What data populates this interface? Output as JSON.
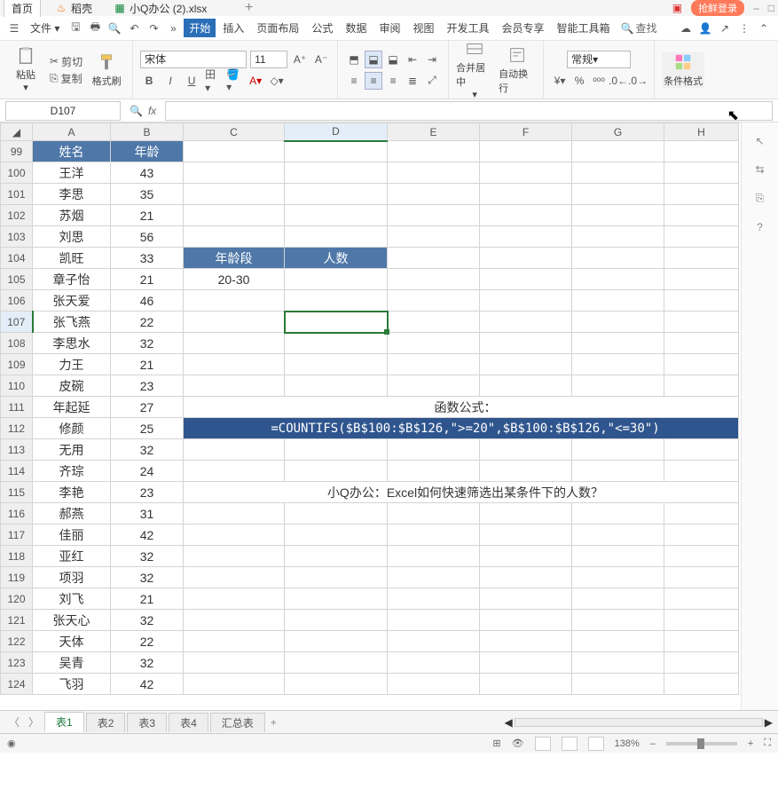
{
  "tabs": {
    "home": "首页",
    "daoke": "稻壳",
    "file": "小Q办公 (2).xlsx"
  },
  "login": "抢鲜登录",
  "menubar": {
    "file": "文件",
    "start": "开始",
    "insert": "插入",
    "layout": "页面布局",
    "formula": "公式",
    "data": "数据",
    "review": "审阅",
    "view": "视图",
    "dev": "开发工具",
    "member": "会员专享",
    "ai": "智能工具箱",
    "find": "查找"
  },
  "ribbon": {
    "paste": "粘贴",
    "cut": "剪切",
    "copy": "复制",
    "format": "格式刷",
    "font": "宋体",
    "size": "11",
    "merge": "合并居中",
    "wrap": "自动换行",
    "numformat": "常规",
    "cond": "条件格式"
  },
  "namebox": "D107",
  "cols": [
    "A",
    "B",
    "C",
    "D",
    "E",
    "F",
    "G",
    "H"
  ],
  "rows": [
    {
      "n": "99",
      "a": "姓名",
      "b": "年龄",
      "hdr": true
    },
    {
      "n": "100",
      "a": "王洋",
      "b": "43"
    },
    {
      "n": "101",
      "a": "李思",
      "b": "35"
    },
    {
      "n": "102",
      "a": "苏烟",
      "b": "21"
    },
    {
      "n": "103",
      "a": "刘思",
      "b": "56"
    },
    {
      "n": "104",
      "a": "凯旺",
      "b": "33",
      "c": "年龄段",
      "d": "人数",
      "chdr": true
    },
    {
      "n": "105",
      "a": "章子怡",
      "b": "21",
      "c": "20-30"
    },
    {
      "n": "106",
      "a": "张天爱",
      "b": "46"
    },
    {
      "n": "107",
      "a": "张飞燕",
      "b": "22",
      "selrow": true
    },
    {
      "n": "108",
      "a": "李思水",
      "b": "32"
    },
    {
      "n": "109",
      "a": "力王",
      "b": "21"
    },
    {
      "n": "110",
      "a": "皮碗",
      "b": "23"
    },
    {
      "n": "111",
      "a": "年起延",
      "b": "27",
      "note_row": "red1"
    },
    {
      "n": "112",
      "a": "修颜",
      "b": "25",
      "note_row": "formula"
    },
    {
      "n": "113",
      "a": "无用",
      "b": "32"
    },
    {
      "n": "114",
      "a": "齐琮",
      "b": "24"
    },
    {
      "n": "115",
      "a": "李艳",
      "b": "23",
      "note_row": "red2"
    },
    {
      "n": "116",
      "a": "郝燕",
      "b": "31"
    },
    {
      "n": "117",
      "a": "佳丽",
      "b": "42"
    },
    {
      "n": "118",
      "a": "亚红",
      "b": "32"
    },
    {
      "n": "119",
      "a": "项羽",
      "b": "32"
    },
    {
      "n": "120",
      "a": "刘飞",
      "b": "21"
    },
    {
      "n": "121",
      "a": "张天心",
      "b": "32"
    },
    {
      "n": "122",
      "a": "天体",
      "b": "22"
    },
    {
      "n": "123",
      "a": "吴青",
      "b": "32"
    },
    {
      "n": "124",
      "a": "飞羽",
      "b": "42"
    }
  ],
  "notes": {
    "red1": "函数公式：",
    "formula": "=COUNTIFS($B$100:$B$126,\">=20\",$B$100:$B$126,\"<=30\")",
    "red2": "小Q办公：Excel如何快速筛选出某条件下的人数？"
  },
  "sheets": [
    "表1",
    "表2",
    "表3",
    "表4",
    "汇总表"
  ],
  "status": {
    "zoom": "138%"
  }
}
